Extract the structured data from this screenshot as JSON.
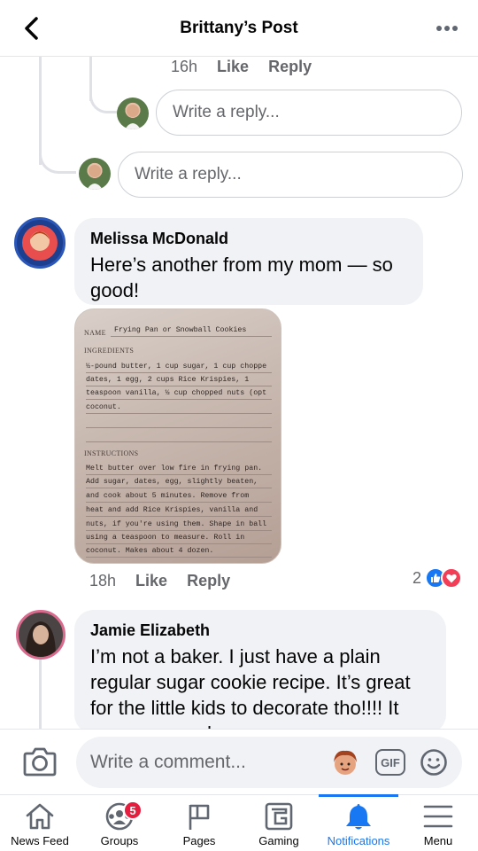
{
  "header": {
    "title": "Brittany’s Post",
    "back_icon": "chevron-left-icon",
    "more_icon": "more-horizontal-icon"
  },
  "previous_comment": {
    "time": "16h",
    "like": "Like",
    "reply": "Reply"
  },
  "reply_inputs": [
    {
      "placeholder": "Write a reply..."
    },
    {
      "placeholder": "Write a reply..."
    }
  ],
  "comments": [
    {
      "author": "Melissa McDonald",
      "text": "Here’s another from my mom — so good!",
      "time": "18h",
      "like": "Like",
      "reply": "Reply",
      "reaction_count": "2",
      "reactions": [
        "like",
        "love"
      ],
      "attachment": {
        "name_label": "NAME",
        "name_value": "Frying Pan or Snowball Cookies",
        "ingredients_label": "INGREDIENTS",
        "ingredients": [
          "½-pound butter, 1 cup sugar, 1 cup choppe",
          "dates, 1 egg, 2 cups Rice Krispies, 1",
          "teaspoon vanilla, ½ cup chopped nuts (opt",
          "coconut."
        ],
        "instructions_label": "INSTRUCTIONS",
        "instructions": [
          "Melt butter over low fire in frying pan.",
          "Add sugar, dates, egg, slightly beaten,",
          "and cook about 5 minutes.  Remove from",
          "heat and add Rice Krispies, vanilla and",
          "nuts, if you're using them.  Shape in ball",
          "using a teaspoon to measure.  Roll in",
          "coconut.  Makes about 4 dozen."
        ]
      }
    },
    {
      "author": "Jamie Elizabeth",
      "text": "I’m not a baker. I just have a plain regular sugar cookie recipe. It’s great for the little kids to decorate tho!!!! It was my grandmas"
    }
  ],
  "comment_bar": {
    "placeholder": "Write a comment...",
    "gif_label": "GIF"
  },
  "nav": [
    {
      "label": "News Feed",
      "icon": "home-icon"
    },
    {
      "label": "Groups",
      "icon": "groups-icon",
      "badge": "5"
    },
    {
      "label": "Pages",
      "icon": "flag-icon"
    },
    {
      "label": "Gaming",
      "icon": "gaming-icon"
    },
    {
      "label": "Notifications",
      "icon": "bell-icon",
      "active": true
    },
    {
      "label": "Menu",
      "icon": "menu-icon"
    }
  ],
  "colors": {
    "accent": "#1877f2",
    "badge": "#e41e3f",
    "love": "#f33e58",
    "bubble": "#f0f2f5"
  }
}
